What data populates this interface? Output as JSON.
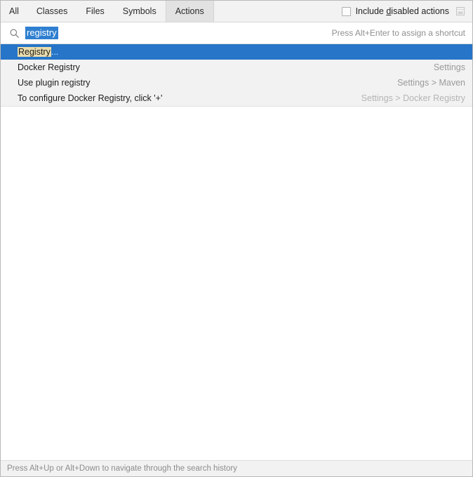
{
  "header": {
    "tabs": [
      {
        "label": "All",
        "selected": false
      },
      {
        "label": "Classes",
        "selected": false
      },
      {
        "label": "Files",
        "selected": false
      },
      {
        "label": "Symbols",
        "selected": false
      },
      {
        "label": "Actions",
        "selected": true
      }
    ],
    "include_disabled": {
      "label_before": "Include ",
      "label_mnemonic": "d",
      "label_after": "isabled actions",
      "checked": false
    },
    "pin_icon": "window-pin-icon"
  },
  "search": {
    "icon": "search-icon",
    "value": "registry",
    "selected": true,
    "hint": "Press Alt+Enter to assign a shortcut"
  },
  "results": [
    {
      "match": "Registry",
      "trail": "...",
      "location": "",
      "selected": true
    },
    {
      "match": "",
      "title": "Docker Registry",
      "trail": "",
      "location": "Settings",
      "selected": false
    },
    {
      "match": "",
      "title": "Use plugin registry",
      "trail": "",
      "location": "Settings > Maven",
      "selected": false
    },
    {
      "match": "",
      "title": "To configure Docker Registry, click '+'",
      "trail": "",
      "location": "Settings > Docker Registry",
      "selected": false
    }
  ],
  "footer": {
    "text": "Press Alt+Up or Alt+Down to navigate through the search history"
  },
  "colors": {
    "selection_blue": "#2675c8",
    "match_highlight": "#e9dcad",
    "text_field_selection": "#2f7fd0",
    "panel_bg": "#f2f2f2",
    "location_gray": "#9a9a9a"
  }
}
